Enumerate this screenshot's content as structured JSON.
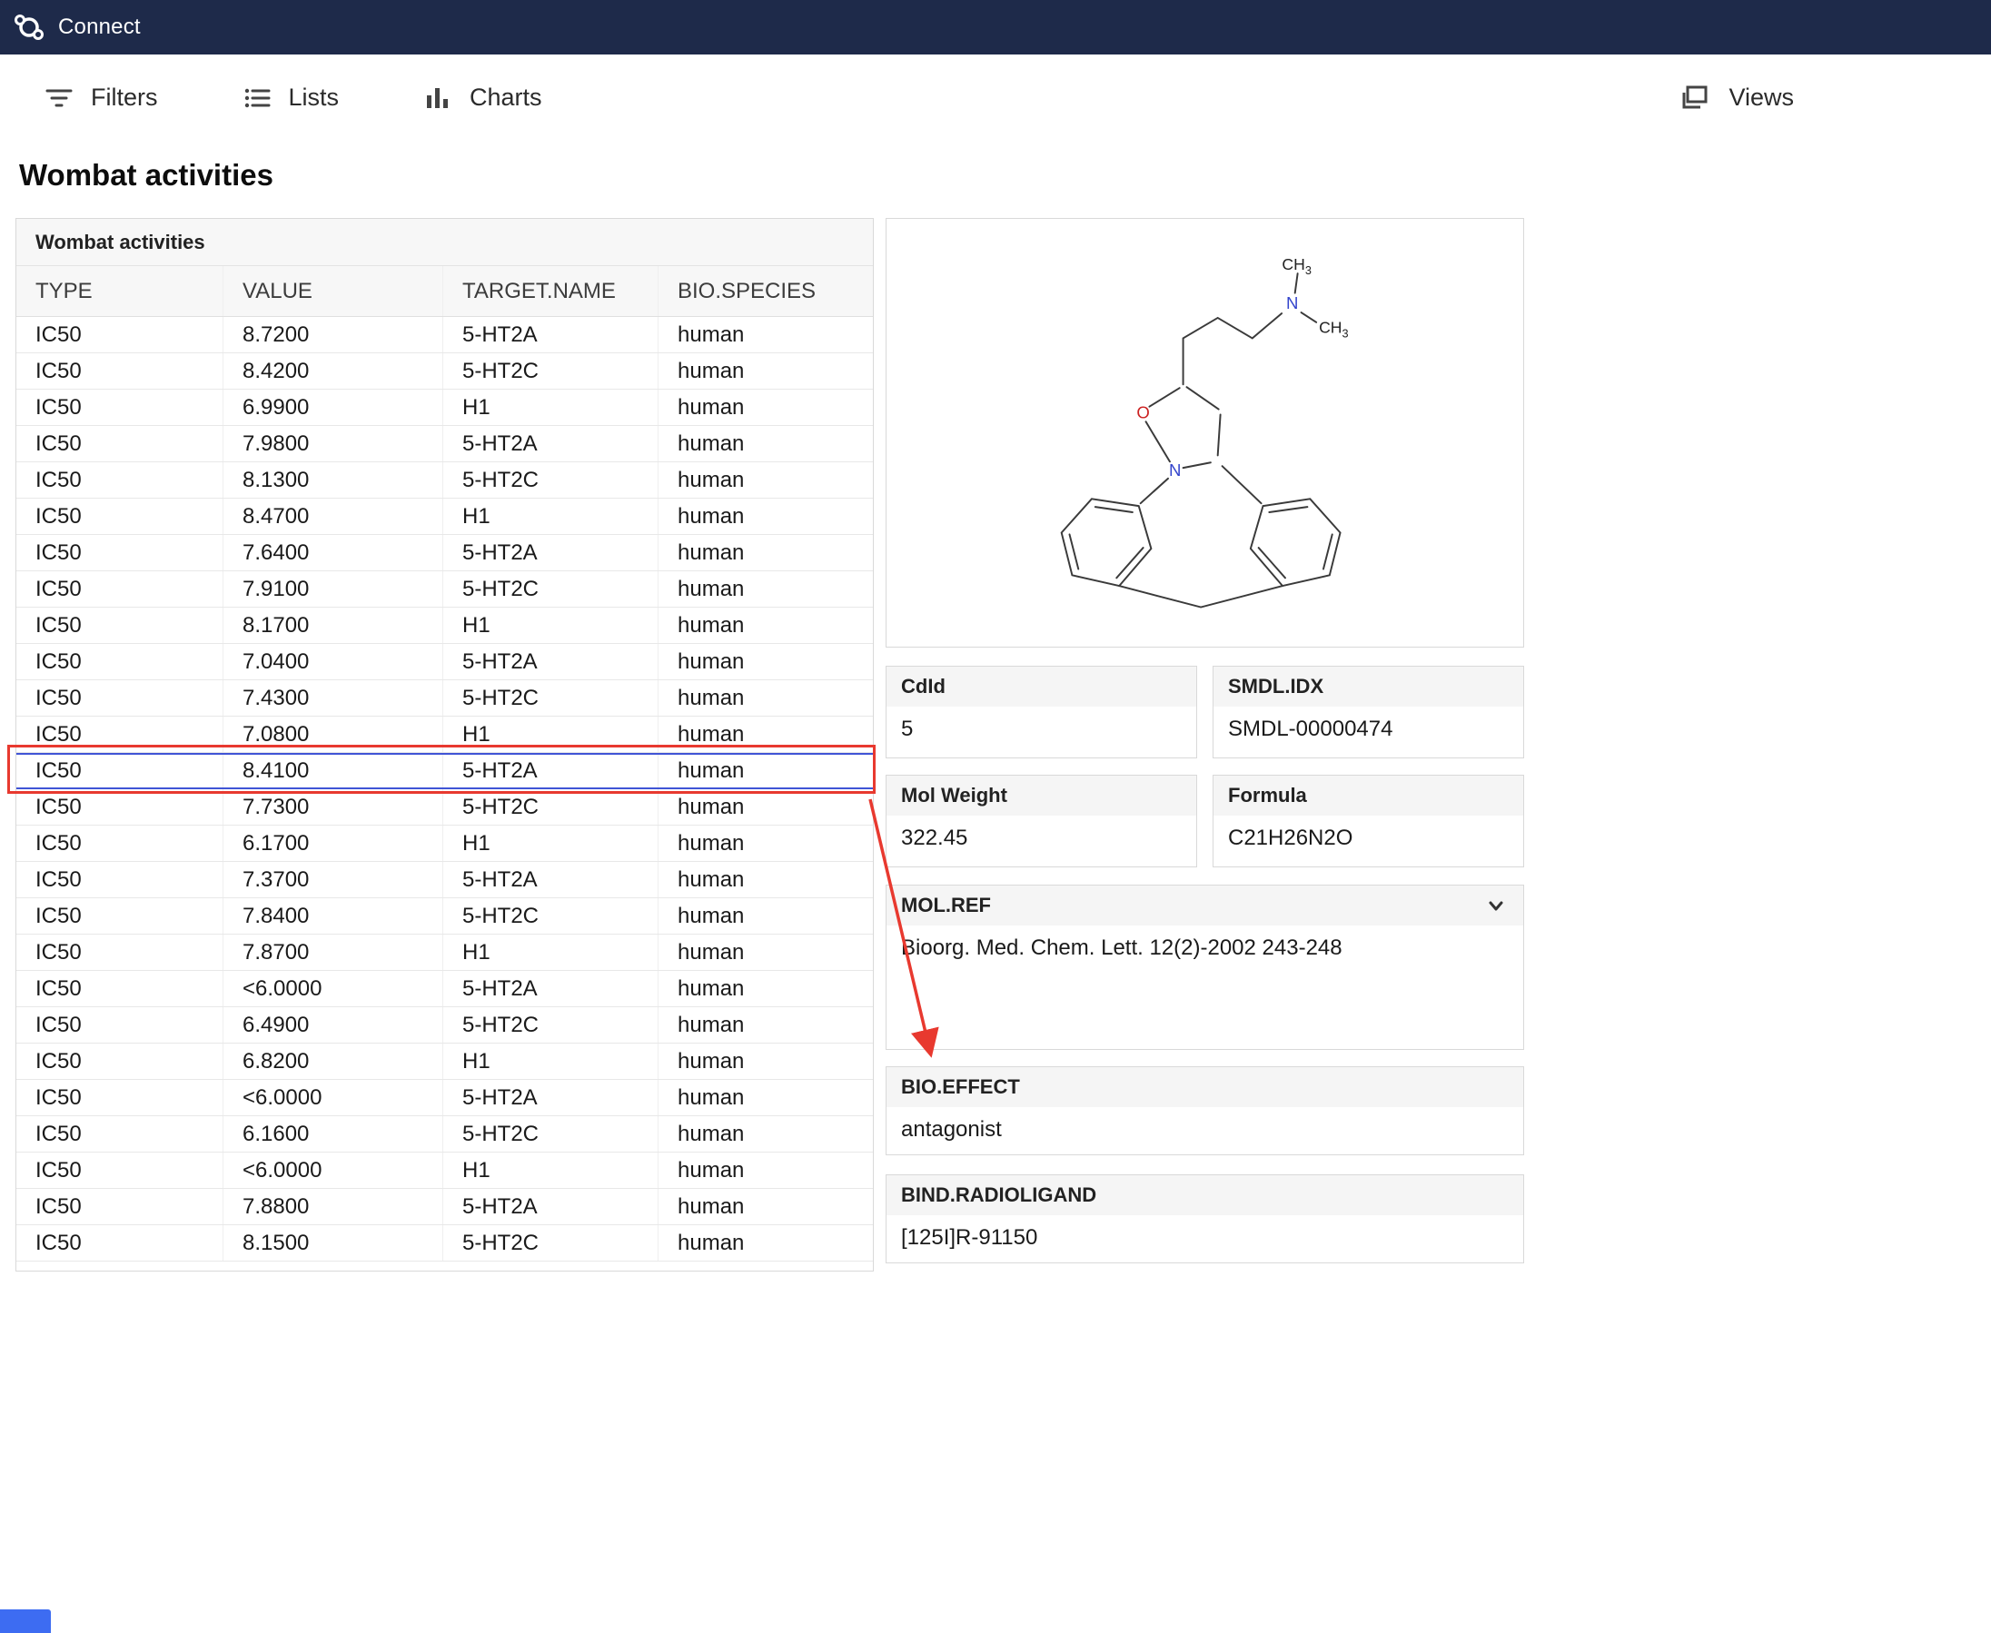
{
  "topbar": {
    "app_name": "Connect"
  },
  "toolbar": {
    "filters_label": "Filters",
    "lists_label": "Lists",
    "charts_label": "Charts",
    "views_label": "Views"
  },
  "page": {
    "title": "Wombat activities"
  },
  "table": {
    "title": "Wombat activities",
    "columns": [
      "TYPE",
      "VALUE",
      "TARGET.NAME",
      "BIO.SPECIES"
    ],
    "selected_row_index": 12,
    "rows": [
      [
        "IC50",
        "8.7200",
        "5-HT2A",
        "human"
      ],
      [
        "IC50",
        "8.4200",
        "5-HT2C",
        "human"
      ],
      [
        "IC50",
        "6.9900",
        "H1",
        "human"
      ],
      [
        "IC50",
        "7.9800",
        "5-HT2A",
        "human"
      ],
      [
        "IC50",
        "8.1300",
        "5-HT2C",
        "human"
      ],
      [
        "IC50",
        "8.4700",
        "H1",
        "human"
      ],
      [
        "IC50",
        "7.6400",
        "5-HT2A",
        "human"
      ],
      [
        "IC50",
        "7.9100",
        "5-HT2C",
        "human"
      ],
      [
        "IC50",
        "8.1700",
        "H1",
        "human"
      ],
      [
        "IC50",
        "7.0400",
        "5-HT2A",
        "human"
      ],
      [
        "IC50",
        "7.4300",
        "5-HT2C",
        "human"
      ],
      [
        "IC50",
        "7.0800",
        "H1",
        "human"
      ],
      [
        "IC50",
        "8.4100",
        "5-HT2A",
        "human"
      ],
      [
        "IC50",
        "7.7300",
        "5-HT2C",
        "human"
      ],
      [
        "IC50",
        "6.1700",
        "H1",
        "human"
      ],
      [
        "IC50",
        "7.3700",
        "5-HT2A",
        "human"
      ],
      [
        "IC50",
        "7.8400",
        "5-HT2C",
        "human"
      ],
      [
        "IC50",
        "7.8700",
        "H1",
        "human"
      ],
      [
        "IC50",
        "<6.0000",
        "5-HT2A",
        "human"
      ],
      [
        "IC50",
        "6.4900",
        "5-HT2C",
        "human"
      ],
      [
        "IC50",
        "6.8200",
        "H1",
        "human"
      ],
      [
        "IC50",
        "<6.0000",
        "5-HT2A",
        "human"
      ],
      [
        "IC50",
        "6.1600",
        "5-HT2C",
        "human"
      ],
      [
        "IC50",
        "<6.0000",
        "H1",
        "human"
      ],
      [
        "IC50",
        "7.8800",
        "5-HT2A",
        "human"
      ],
      [
        "IC50",
        "8.1500",
        "5-HT2C",
        "human"
      ]
    ]
  },
  "details": {
    "cards": [
      {
        "label": "CdId",
        "value": "5"
      },
      {
        "label": "SMDL.IDX",
        "value": "SMDL-00000474"
      },
      {
        "label": "Mol Weight",
        "value": "322.45"
      },
      {
        "label": "Formula",
        "value": "C21H26N2O"
      }
    ],
    "mol_ref": {
      "label": "MOL.REF",
      "value": "Bioorg. Med. Chem. Lett. 12(2)-2002 243-248"
    },
    "bio_effect": {
      "label": "BIO.EFFECT",
      "value": "antagonist"
    },
    "bind_radioligand": {
      "label": "BIND.RADIOLIGAND",
      "value": "[125I]R-91150"
    }
  },
  "molecule": {
    "atom_n": "N",
    "atom_o": "O",
    "methyl": "CH",
    "methyl_sub": "3"
  },
  "colors": {
    "topbar_bg": "#1e2a4a",
    "annotation_red": "#e8392f",
    "selection_blue": "#4054d6",
    "bottom_widget_blue": "#3d6cf2"
  }
}
